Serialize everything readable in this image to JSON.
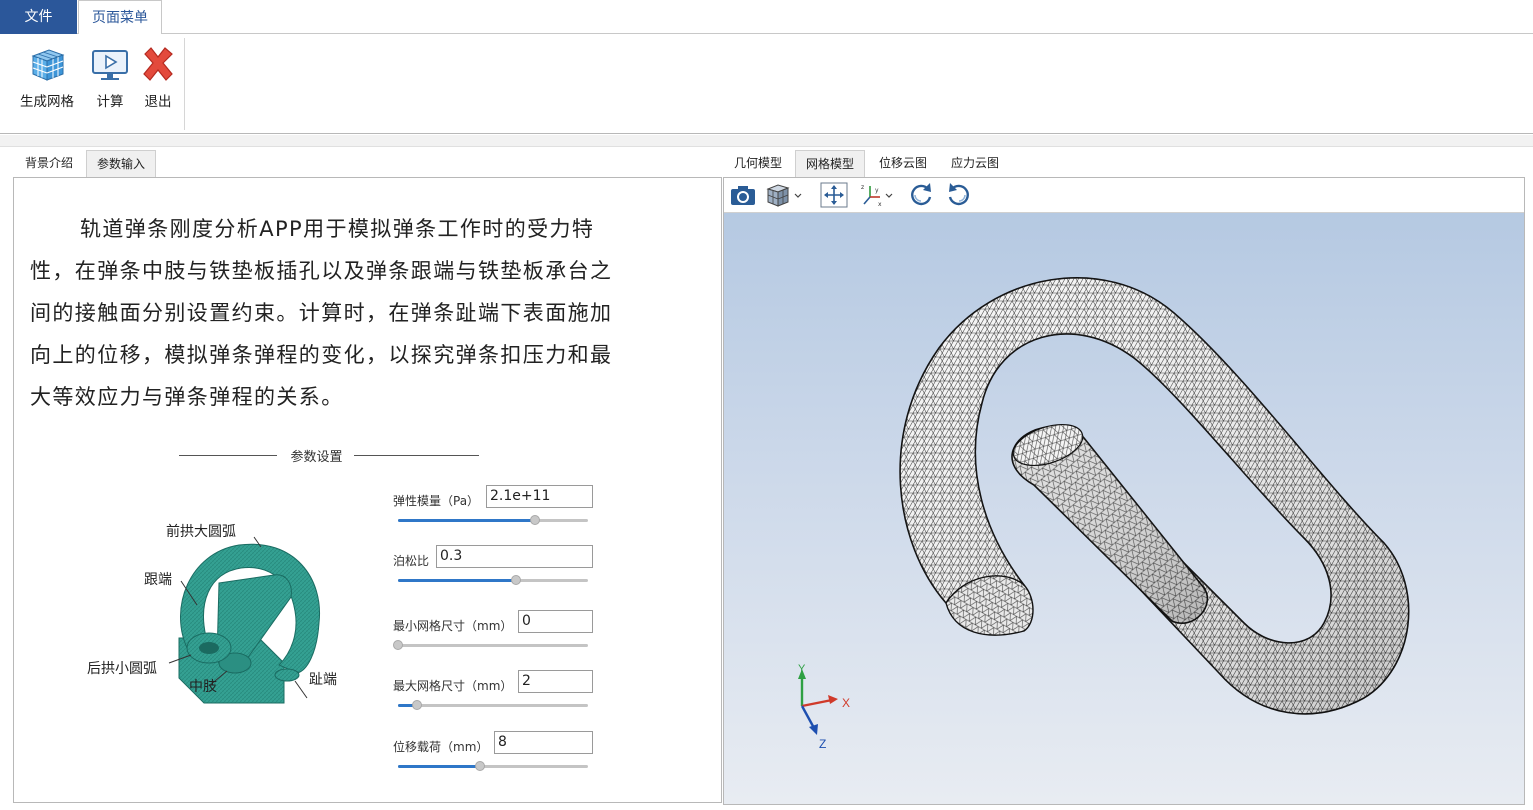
{
  "ribbon": {
    "tabs": [
      "文件",
      "页面菜单"
    ],
    "buttons": {
      "mesh": "生成网格",
      "calc": "计算",
      "quit": "退出"
    }
  },
  "left_tabs": [
    "背景介绍",
    "参数输入"
  ],
  "intro_text": "轨道弹条刚度分析APP用于模拟弹条工作时的受力特性，在弹条中肢与铁垫板插孔以及弹条跟端与铁垫板承台之间的接触面分别设置约束。计算时，在弹条趾端下表面施加向上的位移，模拟弹条弹程的变化，以探究弹条扣压力和最大等效应力与弹条弹程的关系。",
  "param_header": "参数设置",
  "illustration_labels": {
    "front_arc": "前拱大圆弧",
    "heel": "跟端",
    "rear_arc": "后拱小圆弧",
    "middle": "中肢",
    "toe": "趾端"
  },
  "params": [
    {
      "label": "弹性模量（Pa）",
      "value": "2.1e+11",
      "slider": 0.72
    },
    {
      "label": "泊松比",
      "value": "0.3",
      "slider": 0.62
    },
    {
      "label": "最小网格尺寸（mm）",
      "value": "0",
      "slider": 0.0
    },
    {
      "label": "最大网格尺寸（mm）",
      "value": "2",
      "slider": 0.1
    },
    {
      "label": "位移载荷（mm）",
      "value": "8",
      "slider": 0.43
    }
  ],
  "viewer_tabs": [
    "几何模型",
    "网格模型",
    "位移云图",
    "应力云图"
  ],
  "toolbar_icons": [
    "camera-icon",
    "view-cube-icon",
    "fit-view-icon",
    "axes-icon",
    "rotate-cw-icon",
    "rotate-ccw-icon"
  ],
  "axes": {
    "x": "X",
    "y": "Y",
    "z": "Z"
  },
  "colors": {
    "accent": "#2b579a",
    "mesh_line": "#2a2a2a",
    "model_teal": "#2e9a8c"
  }
}
